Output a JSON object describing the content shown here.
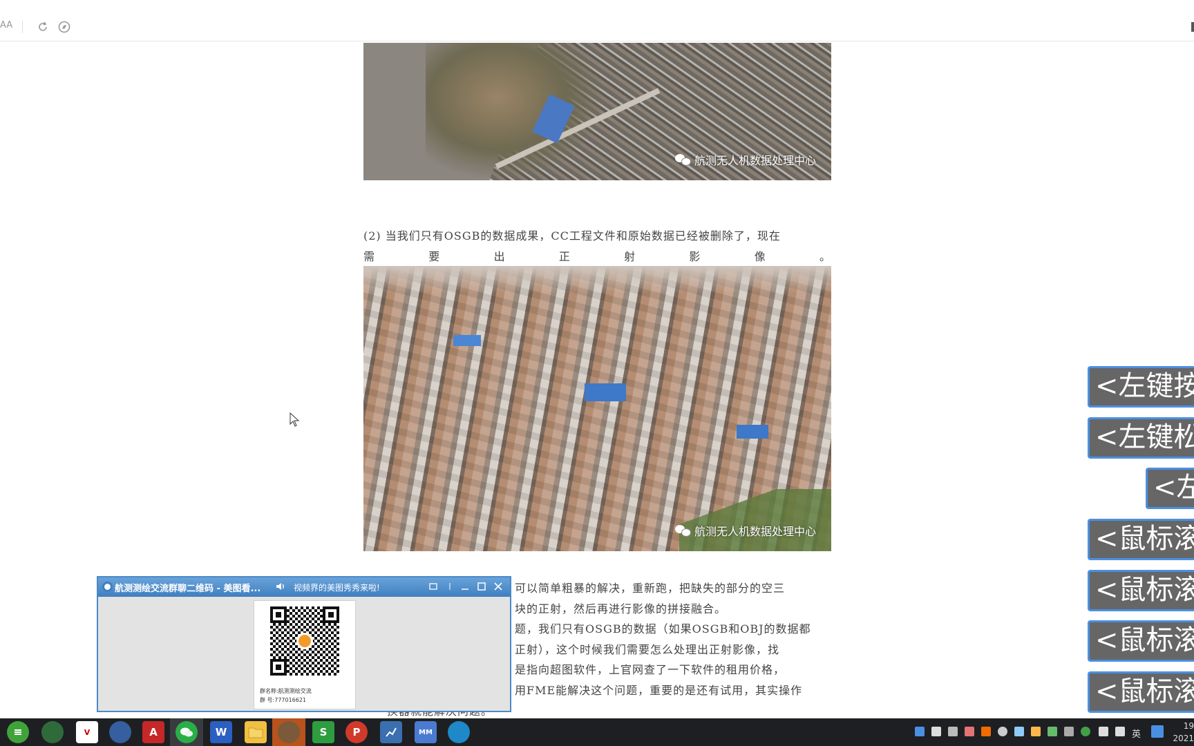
{
  "toolbar": {
    "font_size_label": "AA"
  },
  "images": {
    "top_watermark": "航测无人机数据处理中心",
    "main_watermark": "航测无人机数据处理中心"
  },
  "article": {
    "para2_line1": "(2)  当我们只有OSGB的数据成果，CC工程文件和原始数据已经被删除了，现在",
    "para2_line2_chars": [
      "需",
      "要",
      "出",
      "正",
      "射",
      "影",
      "像",
      "。"
    ],
    "para3_lines": [
      "可以简单粗暴的解决，重新跑，把缺失的部分的空三",
      "块的正射，然后再进行影像的拼接融合。",
      "题，我们只有OSGB的数据（如果OSGB和OBJ的数据都",
      "正射），这个时候我们需要怎么处理出正射影像，找",
      "是指向超图软件，上官网查了一下软件的租用价格，",
      "用FME能解决这个问题，重要的是还有试用，其实操作",
      "换器就能解决问题。"
    ]
  },
  "popup": {
    "title": "航测测绘交流群聊二维码 - 美图看...",
    "notice": "视频界的美图秀秀来啦!",
    "qr_caption_line1": "群名称:航测测绘交流",
    "qr_caption_line2": "群  号:777016621"
  },
  "key_overlay": [
    "<左键按",
    "<左键松",
    "<左",
    "<鼠标滚",
    "<鼠标滚",
    "<鼠标滚",
    "<鼠标滚"
  ],
  "taskbar": {
    "tray_lang": "英",
    "clock_time": "19",
    "clock_date": "2021"
  },
  "colors": {
    "accent": "#4a90e2",
    "taskbar": "#1e1f22",
    "key_bg": "#666666"
  }
}
